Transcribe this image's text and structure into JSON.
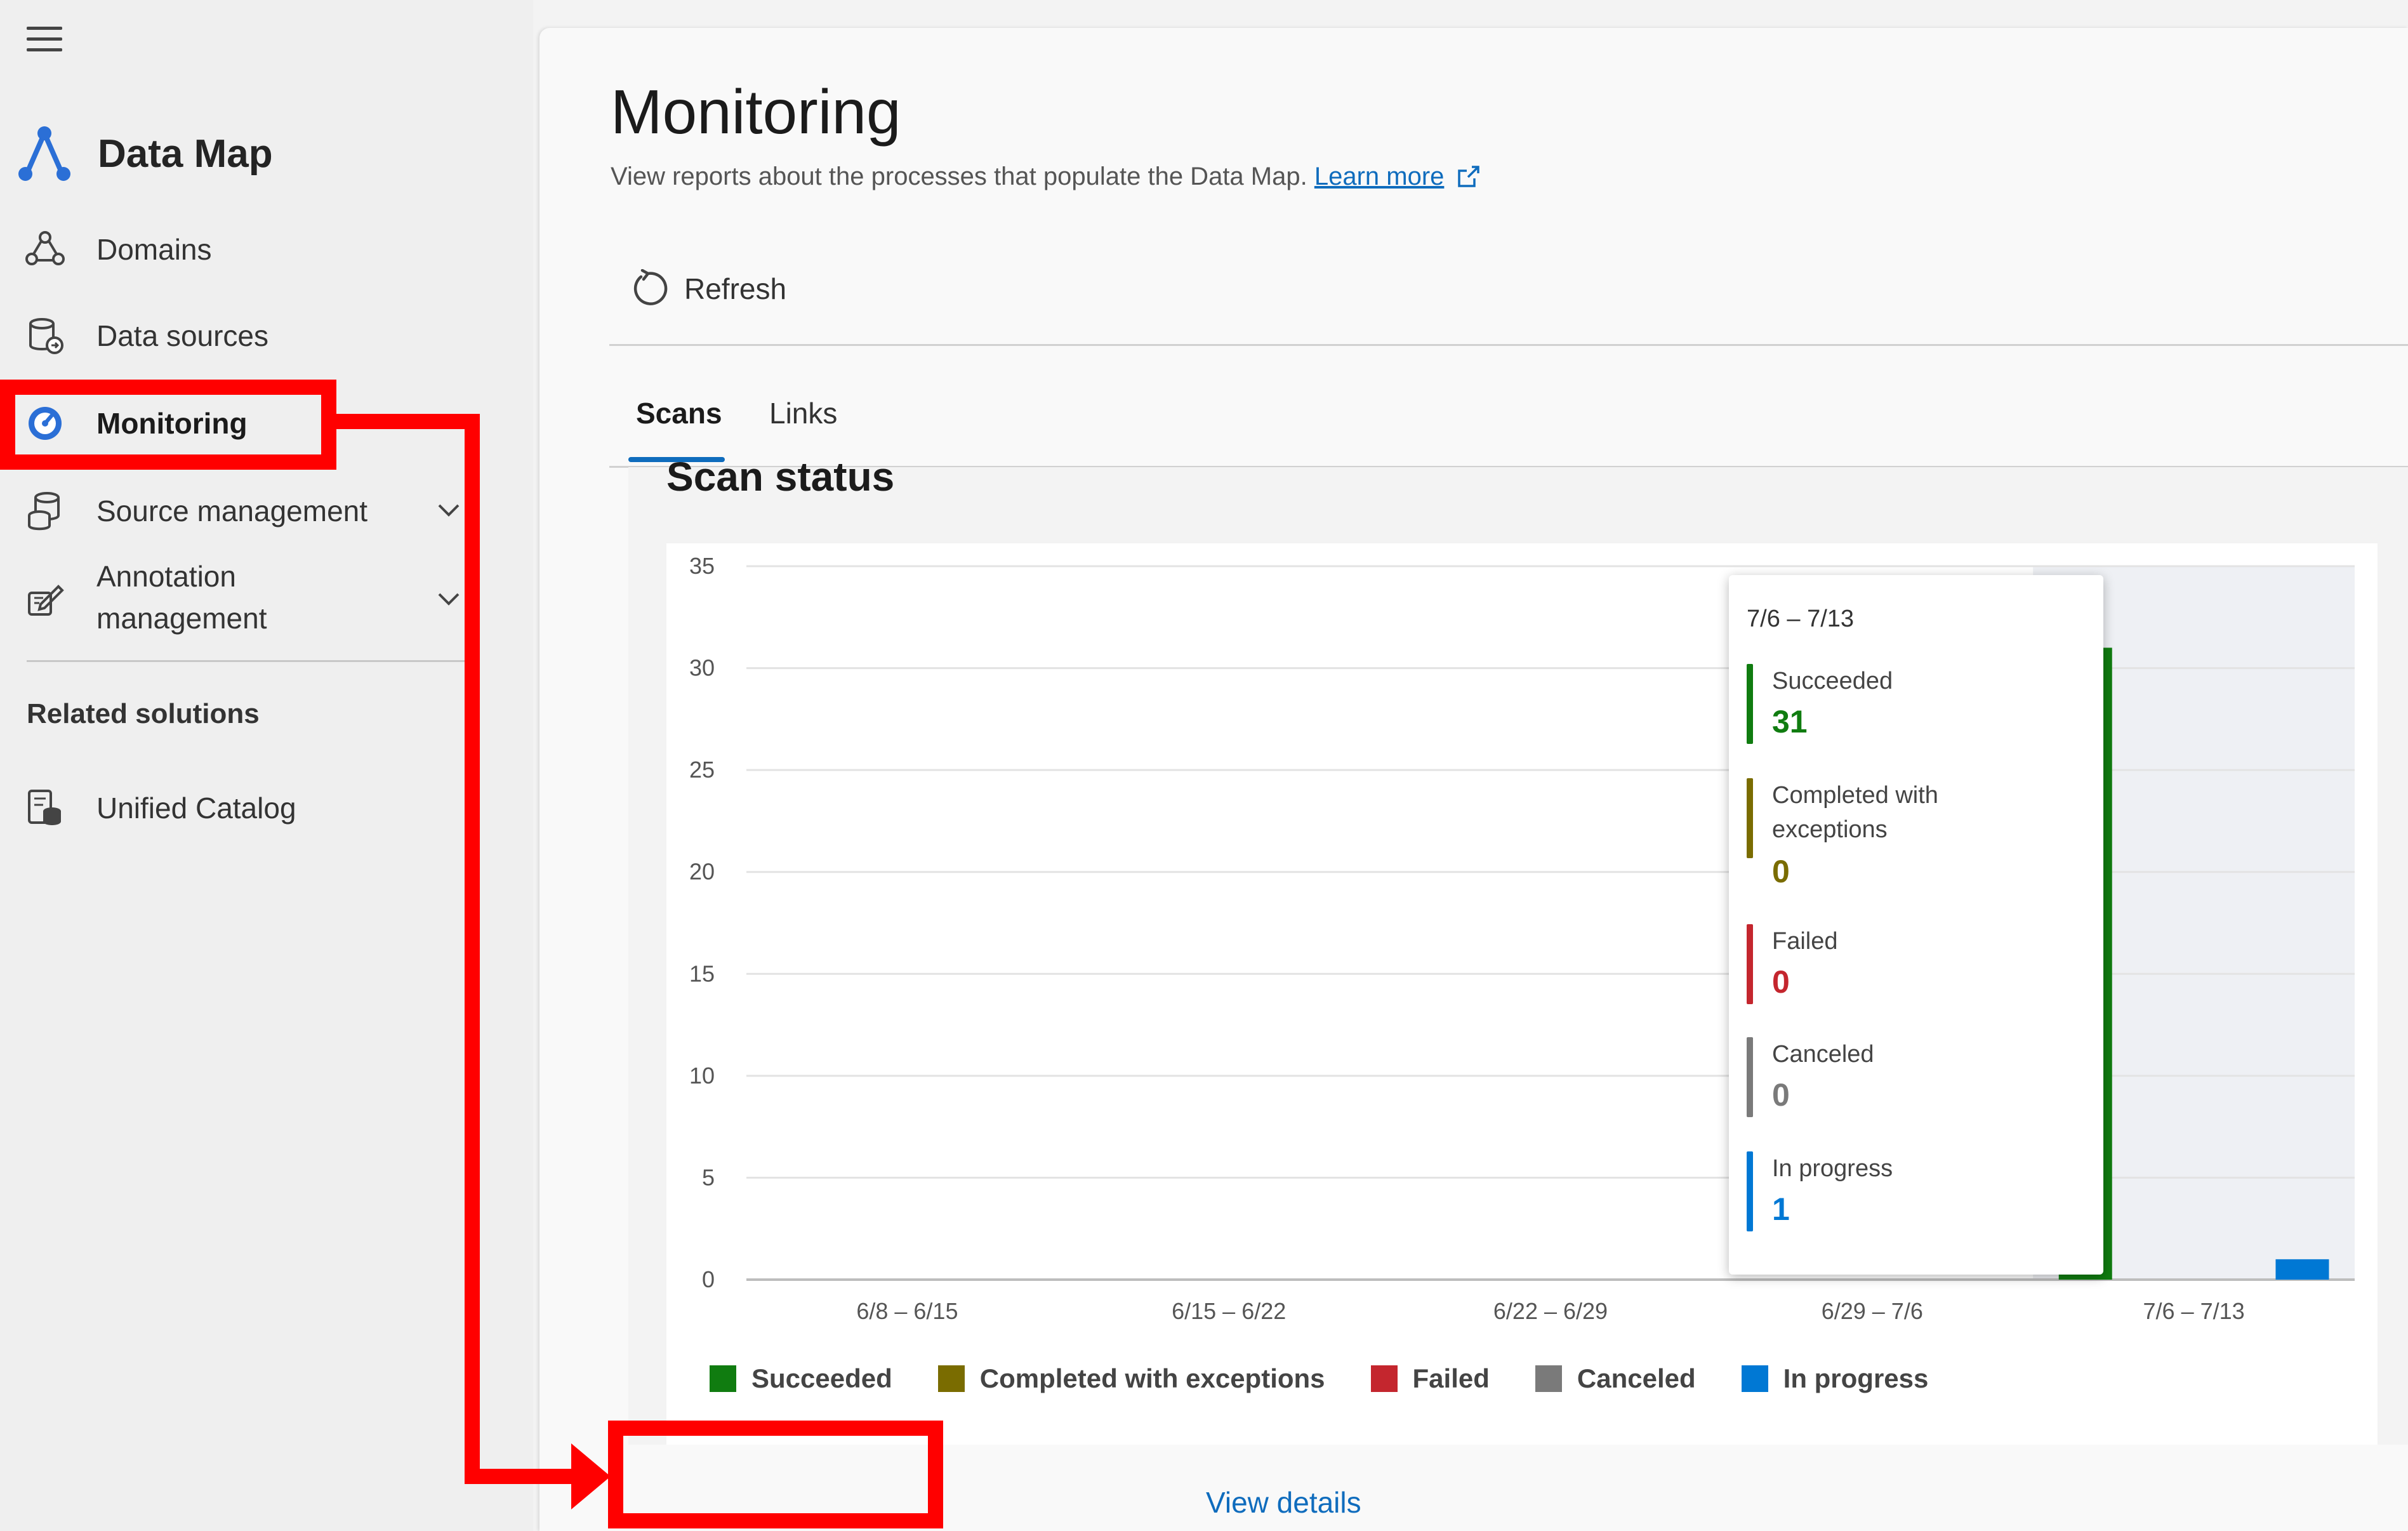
{
  "sidebar": {
    "brand": "Data Map",
    "items": [
      {
        "label": "Domains",
        "icon": "domains-icon"
      },
      {
        "label": "Data sources",
        "icon": "data-sources-icon"
      },
      {
        "label": "Monitoring",
        "icon": "monitoring-icon",
        "active": true
      },
      {
        "label": "Source management",
        "icon": "source-management-icon",
        "expandable": true
      },
      {
        "label": "Annotation management",
        "label_line1": "Annotation",
        "label_line2": "management",
        "icon": "annotation-icon",
        "expandable": true
      }
    ],
    "related_heading": "Related solutions",
    "related_items": [
      {
        "label": "Unified Catalog",
        "icon": "catalog-icon"
      }
    ]
  },
  "page": {
    "title": "Monitoring",
    "description": "View reports about the processes that populate the Data Map.",
    "learn_more": "Learn more",
    "toolbar": {
      "refresh_label": "Refresh"
    },
    "tabs": [
      {
        "label": "Scans",
        "active": true
      },
      {
        "label": "Links"
      }
    ],
    "section_title": "Scan status",
    "view_details": "View details"
  },
  "colors": {
    "succeeded": "#107c10",
    "completed_with_exceptions": "#7a6c00",
    "failed": "#c4262e",
    "canceled": "#7a7a7a",
    "in_progress": "#0078d4",
    "accent": "#0f6cbd",
    "annotation": "#ff0000"
  },
  "chart_data": {
    "type": "bar",
    "title": "Scan status",
    "categories": [
      "6/8 – 6/15",
      "6/15 – 6/22",
      "6/22 – 6/29",
      "6/29 – 7/6",
      "7/6 – 7/13"
    ],
    "series": [
      {
        "name": "Succeeded",
        "values": [
          0,
          0,
          0,
          0,
          31
        ]
      },
      {
        "name": "Completed with exceptions",
        "values": [
          0,
          0,
          0,
          0,
          0
        ]
      },
      {
        "name": "Failed",
        "values": [
          0,
          0,
          0,
          0,
          0
        ]
      },
      {
        "name": "Canceled",
        "values": [
          0,
          0,
          0,
          0,
          0
        ]
      },
      {
        "name": "In progress",
        "values": [
          0,
          0,
          0,
          0,
          1
        ]
      }
    ],
    "ylim": [
      0,
      35
    ],
    "yticks": [
      0,
      5,
      10,
      15,
      20,
      25,
      30,
      35
    ],
    "grid": true,
    "legend": "bottom",
    "highlighted_category": "7/6 – 7/13"
  },
  "tooltip": {
    "title": "7/6 – 7/13",
    "rows": [
      {
        "name": "Succeeded",
        "value": "31"
      },
      {
        "name": "Completed with exceptions",
        "name_line1": "Completed with",
        "name_line2": "exceptions",
        "value": "0"
      },
      {
        "name": "Failed",
        "value": "0"
      },
      {
        "name": "Canceled",
        "value": "0"
      },
      {
        "name": "In progress",
        "value": "1"
      }
    ]
  }
}
